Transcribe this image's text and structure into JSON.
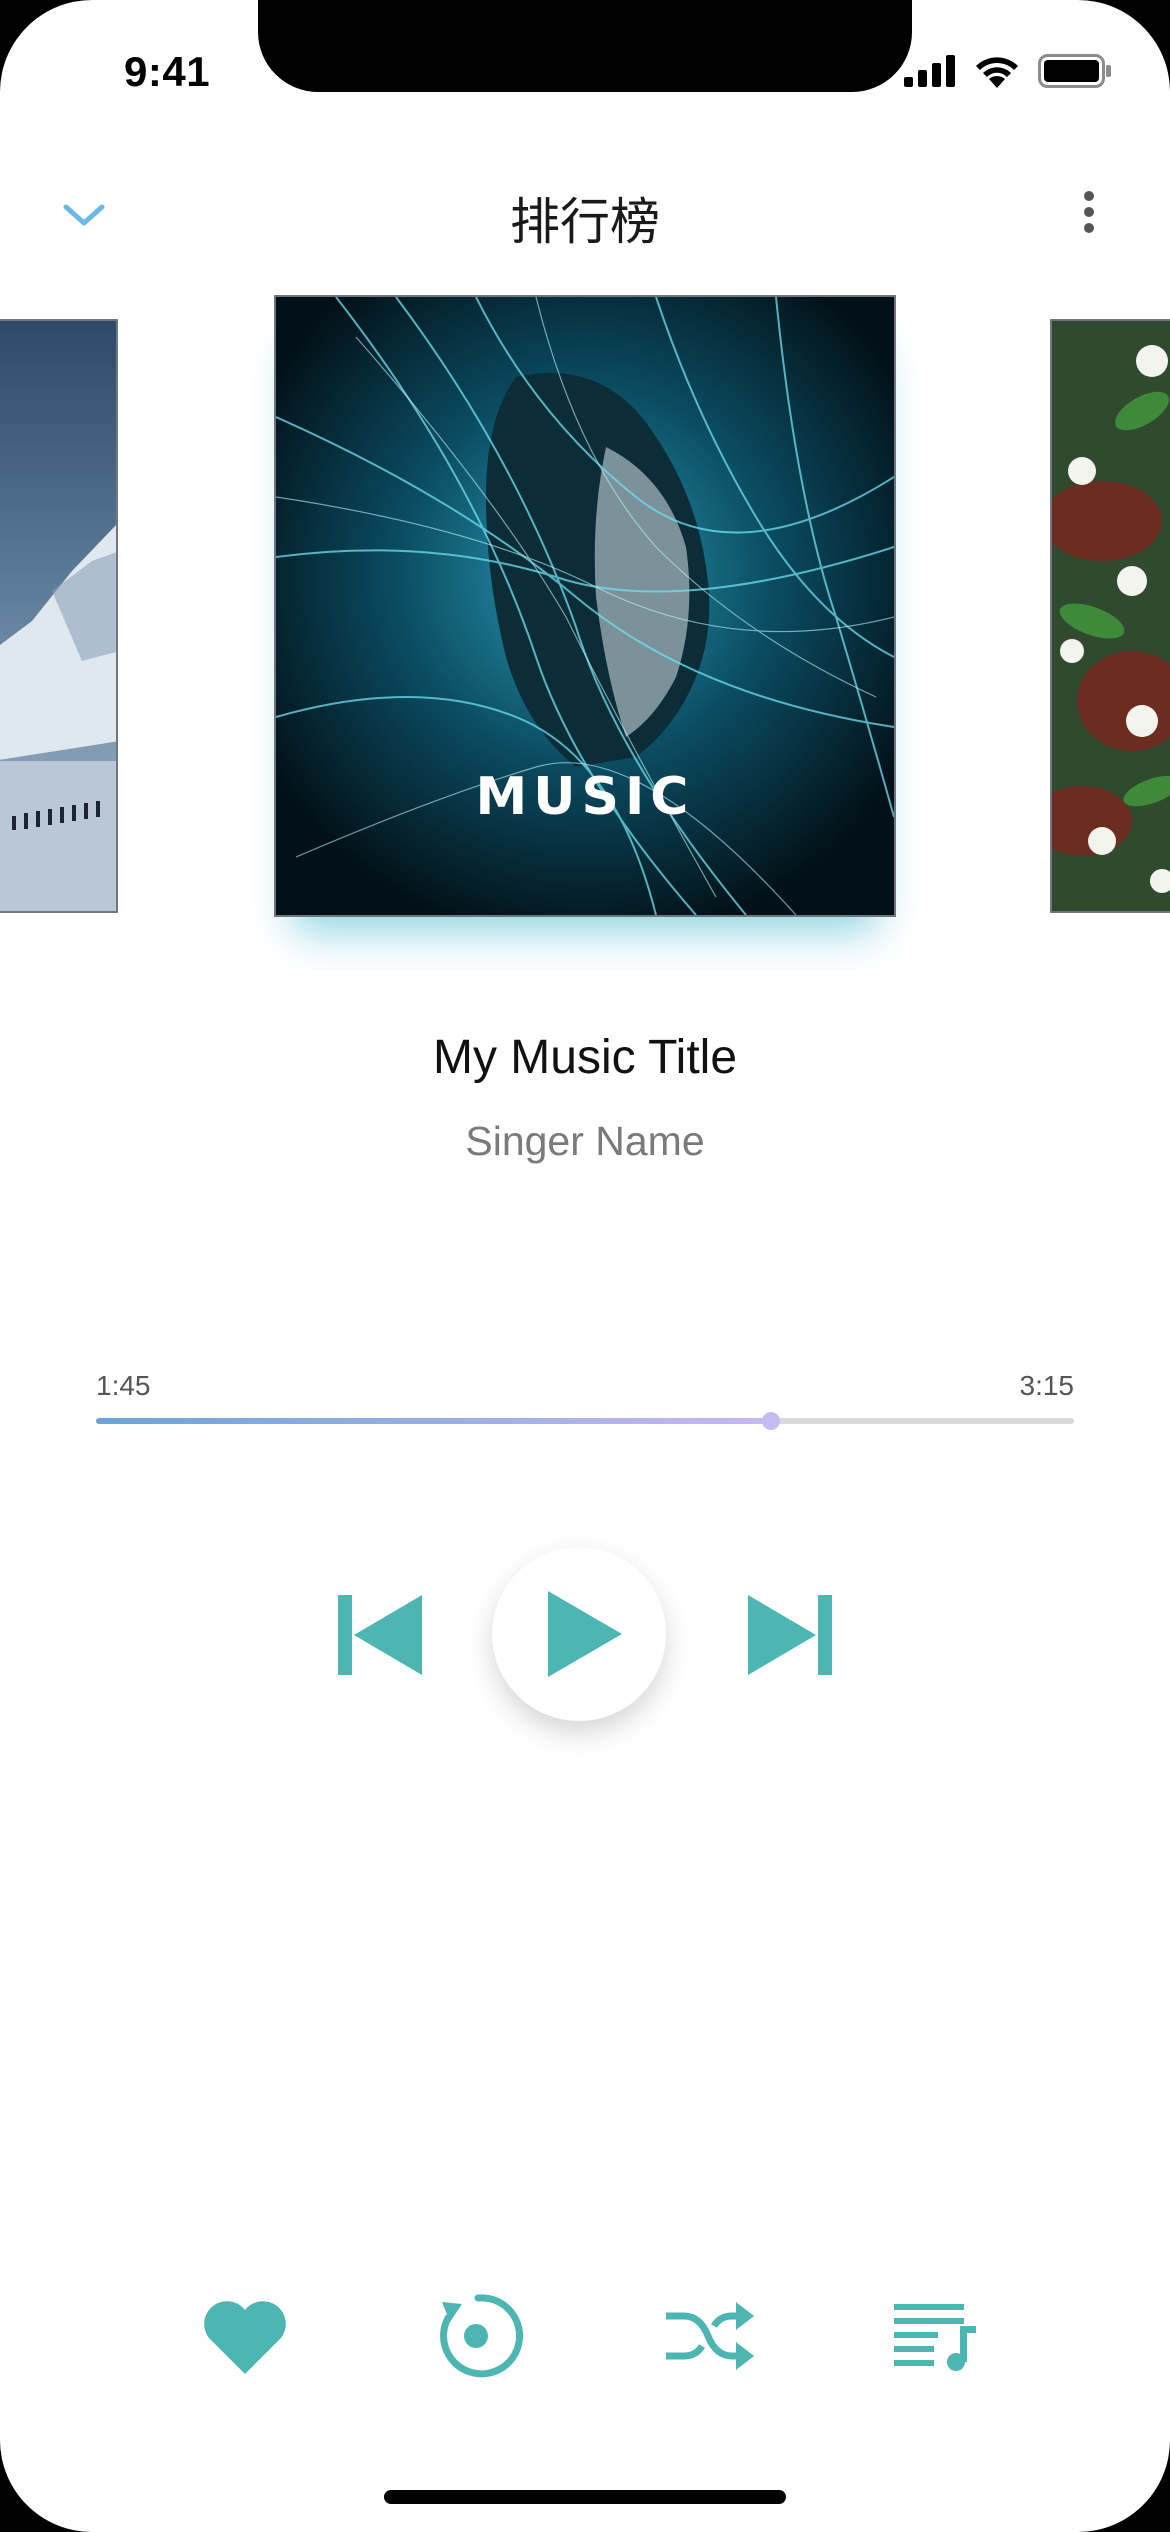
{
  "status_bar": {
    "time": "9:41"
  },
  "header": {
    "title": "排行榜"
  },
  "now_playing": {
    "cover_text": "MUSIC",
    "song_title": "My Music Title",
    "singer": "Singer Name"
  },
  "progress": {
    "current": "1:45",
    "total": "3:15",
    "fraction": 0.69
  },
  "colors": {
    "accent": "#4db6b2",
    "back_chevron": "#6bb8e8"
  },
  "icons": {
    "back": "chevron-down-icon",
    "more": "more-vertical-icon",
    "prev": "skip-previous-icon",
    "play": "play-icon",
    "next": "skip-next-icon",
    "favorite": "heart-icon",
    "repeat": "repeat-icon",
    "shuffle": "shuffle-icon",
    "playlist": "playlist-icon"
  }
}
